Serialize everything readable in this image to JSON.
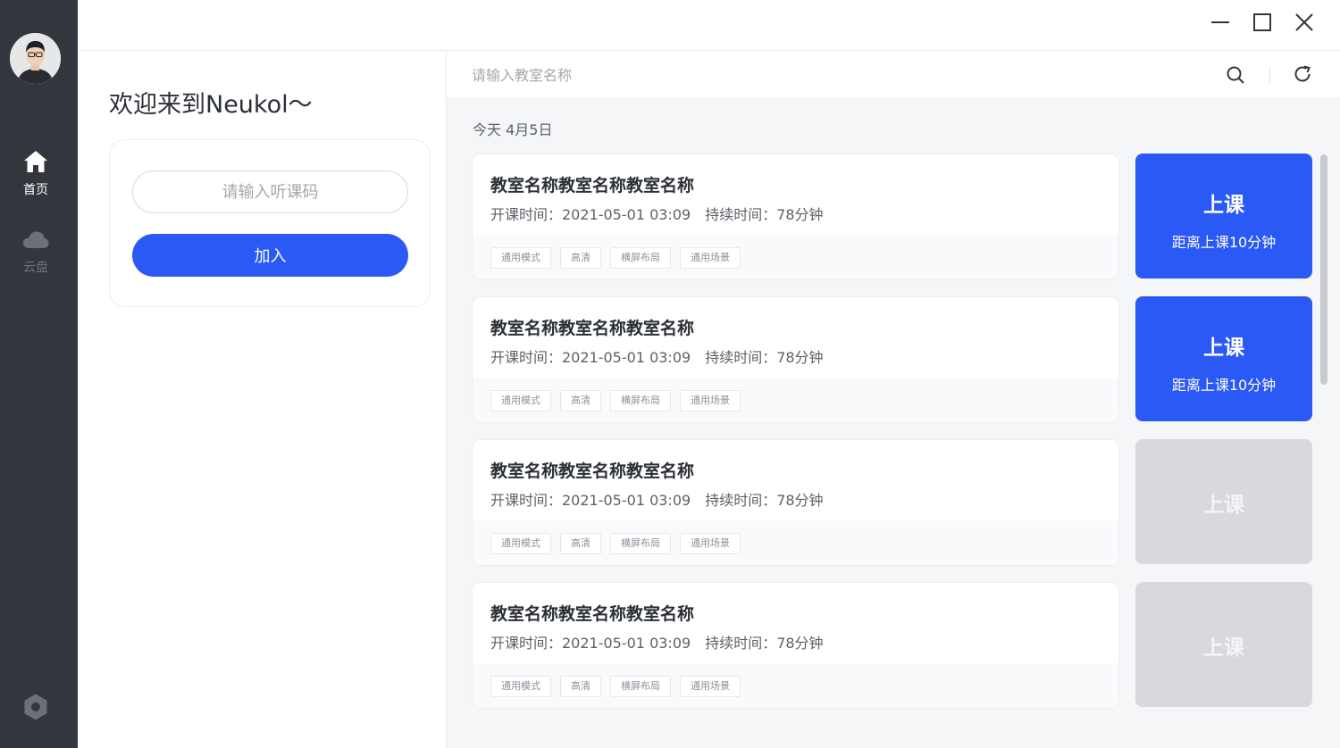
{
  "sidebar": {
    "nav": [
      {
        "label": "首页",
        "icon": "home-icon",
        "active": true
      },
      {
        "label": "云盘",
        "icon": "cloud-icon",
        "active": false
      }
    ],
    "settings_icon": "settings-icon"
  },
  "window": {
    "controls": [
      "minimize",
      "maximize",
      "close"
    ]
  },
  "left": {
    "welcome": "欢迎来到Neukol～",
    "code_placeholder": "请输入听课码",
    "join_label": "加入"
  },
  "right": {
    "search_placeholder": "请输入教室名称",
    "date": "今天 4月5日",
    "rooms": [
      {
        "name": "教室名称教室名称教室名称",
        "start": "开课时间：2021-05-01 03:09",
        "duration": "持续时间：78分钟",
        "tags": [
          "通用模式",
          "高清",
          "横屏布局",
          "通用场景"
        ],
        "action": "上课",
        "countdown": "距离上课10分钟",
        "state": "active"
      },
      {
        "name": "教室名称教室名称教室名称",
        "start": "开课时间：2021-05-01 03:09",
        "duration": "持续时间：78分钟",
        "tags": [
          "通用模式",
          "高清",
          "横屏布局",
          "通用场景"
        ],
        "action": "上课",
        "countdown": "距离上课10分钟",
        "state": "active"
      },
      {
        "name": "教室名称教室名称教室名称",
        "start": "开课时间：2021-05-01 03:09",
        "duration": "持续时间：78分钟",
        "tags": [
          "通用模式",
          "高清",
          "横屏布局",
          "通用场景"
        ],
        "action": "上课",
        "countdown": "",
        "state": "disabled"
      },
      {
        "name": "教室名称教室名称教室名称",
        "start": "开课时间：2021-05-01 03:09",
        "duration": "持续时间：78分钟",
        "tags": [
          "通用模式",
          "高清",
          "横屏布局",
          "通用场景"
        ],
        "action": "上课",
        "countdown": "",
        "state": "disabled"
      }
    ]
  },
  "colors": {
    "accent": "#2b59f5",
    "rail": "#33363d",
    "disabled": "#d7d9de"
  }
}
